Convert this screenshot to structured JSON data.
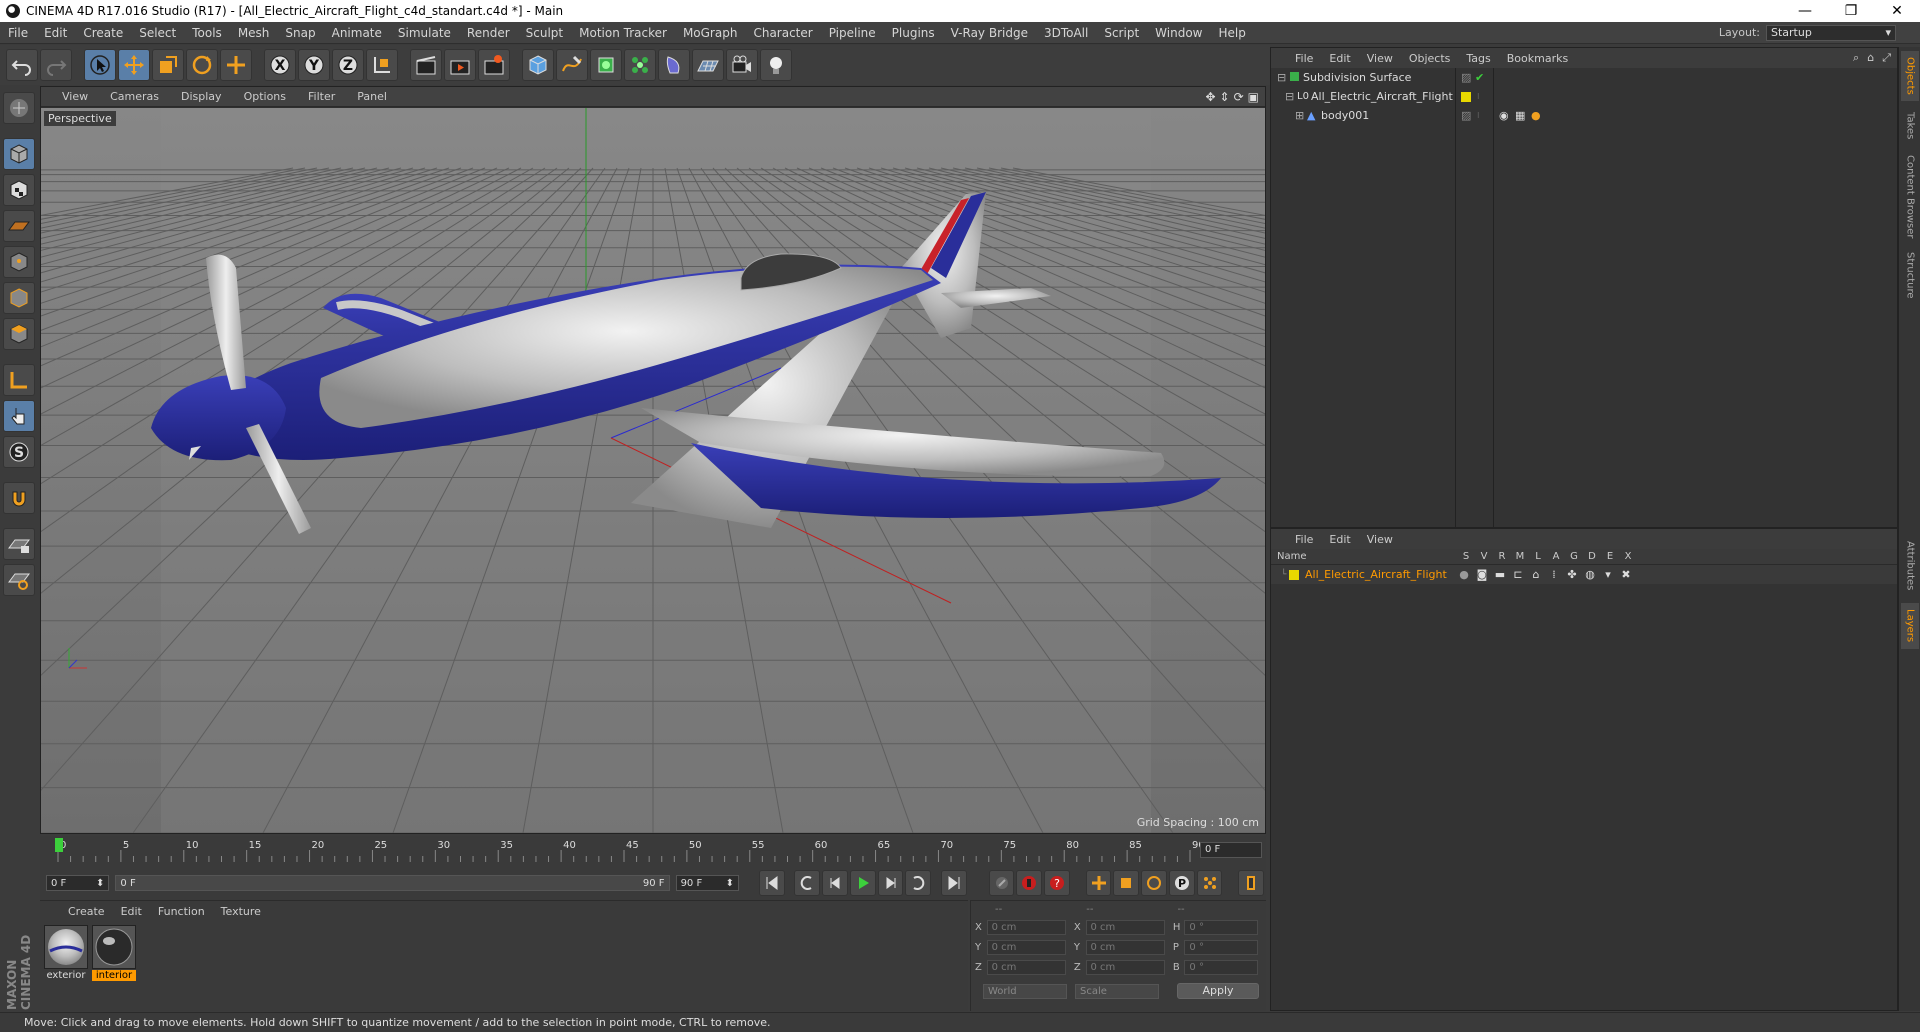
{
  "window": {
    "title": "CINEMA 4D R17.016 Studio (R17) - [All_Electric_Aircraft_Flight_c4d_standart.c4d *] - Main",
    "minimize": "—",
    "restore": "❐",
    "close": "✕"
  },
  "menu": {
    "items": [
      "File",
      "Edit",
      "Create",
      "Select",
      "Tools",
      "Mesh",
      "Snap",
      "Animate",
      "Simulate",
      "Render",
      "Sculpt",
      "Motion Tracker",
      "MoGraph",
      "Character",
      "Pipeline",
      "Plugins",
      "V-Ray Bridge",
      "3DToAll",
      "Script",
      "Window",
      "Help"
    ],
    "layout_label": "Layout:",
    "layout_value": "Startup"
  },
  "viewport": {
    "menu": [
      "View",
      "Cameras",
      "Display",
      "Options",
      "Filter",
      "Panel"
    ],
    "label": "Perspective",
    "grid_spacing": "Grid Spacing : 100 cm"
  },
  "timeline": {
    "ticks": [
      "0",
      "5",
      "10",
      "15",
      "20",
      "25",
      "30",
      "35",
      "40",
      "45",
      "50",
      "55",
      "60",
      "65",
      "70",
      "75",
      "80",
      "85",
      "90"
    ],
    "current_frame": "0 F",
    "start_field": "0 F",
    "range_start": "0 F",
    "range_end": "90 F",
    "end_field": "90 F"
  },
  "materials": {
    "menu": [
      "Create",
      "Edit",
      "Function",
      "Texture"
    ],
    "items": [
      {
        "name": "exterior",
        "selected": false
      },
      {
        "name": "interior",
        "selected": true
      }
    ]
  },
  "coords": {
    "headers": [
      "--",
      "--",
      "--"
    ],
    "rows": [
      {
        "a": "X",
        "av": "0 cm",
        "b": "X",
        "bv": "0 cm",
        "c": "H",
        "cv": "0 °"
      },
      {
        "a": "Y",
        "av": "0 cm",
        "b": "Y",
        "bv": "0 cm",
        "c": "P",
        "cv": "0 °"
      },
      {
        "a": "Z",
        "av": "0 cm",
        "b": "Z",
        "bv": "0 cm",
        "c": "B",
        "cv": "0 °"
      }
    ],
    "world": "World",
    "scale": "Scale",
    "apply": "Apply"
  },
  "status": "Move: Click and drag to move elements. Hold down SHIFT to quantize movement / add to the selection in point mode, CTRL to remove.",
  "brand": "MAXON CINEMA 4D",
  "objects": {
    "menu": [
      "File",
      "Edit",
      "View",
      "Objects",
      "Tags",
      "Bookmarks"
    ],
    "items": [
      {
        "name": "Subdivision Surface",
        "indent": 0
      },
      {
        "name": "All_Electric_Aircraft_Flight",
        "indent": 1
      },
      {
        "name": "body001",
        "indent": 2
      }
    ]
  },
  "layers": {
    "menu": [
      "File",
      "Edit",
      "View"
    ],
    "columns": [
      "Name",
      "S",
      "V",
      "R",
      "M",
      "L",
      "A",
      "G",
      "D",
      "E",
      "X"
    ],
    "items": [
      {
        "name": "All_Electric_Aircraft_Flight"
      }
    ]
  },
  "side_tabs": [
    "Objects",
    "Takes",
    "Content Browser",
    "Structure",
    "Attributes",
    "Layers"
  ],
  "colors": {
    "accent": "#ff9a00",
    "layer_color": "#e8d800",
    "aircraft_blue": "#2a2e9a",
    "aircraft_silver": "#b8b8b8"
  }
}
